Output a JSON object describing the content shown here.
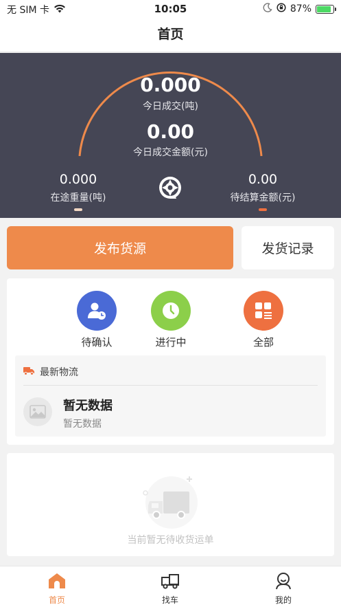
{
  "status_bar": {
    "carrier": "无 SIM 卡",
    "time": "10:05",
    "battery": "87%",
    "battery_level": 0.87
  },
  "nav": {
    "title": "首页"
  },
  "dashboard": {
    "today_volume_value": "0.000",
    "today_volume_label": "今日成交(吨)",
    "today_amount_value": "0.00",
    "today_amount_label": "今日成交金额(元)",
    "transit_weight_value": "0.000",
    "transit_weight_label": "在途重量(吨)",
    "pending_settle_value": "0.00",
    "pending_settle_label": "待结算金额(元)",
    "arc_color": "#ee8a4b",
    "bg_color": "#454655"
  },
  "actions": {
    "publish_label": "发布货源",
    "records_label": "发货记录"
  },
  "order_status": {
    "items": [
      {
        "label": "待确认",
        "icon": "user-clock-icon",
        "color": "#4a6ad6"
      },
      {
        "label": "进行中",
        "icon": "clock-icon",
        "color": "#8ccf4a"
      },
      {
        "label": "全部",
        "icon": "grid-list-icon",
        "color": "#ee7040"
      }
    ]
  },
  "logistics": {
    "header": "最新物流",
    "title": "暂无数据",
    "subtitle": "暂无数据"
  },
  "empty": {
    "text": "当前暂无待收货运单"
  },
  "tabbar": {
    "tabs": [
      {
        "label": "首页",
        "icon": "home-icon",
        "active": true
      },
      {
        "label": "找车",
        "icon": "truck-icon",
        "active": false
      },
      {
        "label": "我的",
        "icon": "profile-icon",
        "active": false
      }
    ],
    "active_color": "#ee8a4b"
  }
}
